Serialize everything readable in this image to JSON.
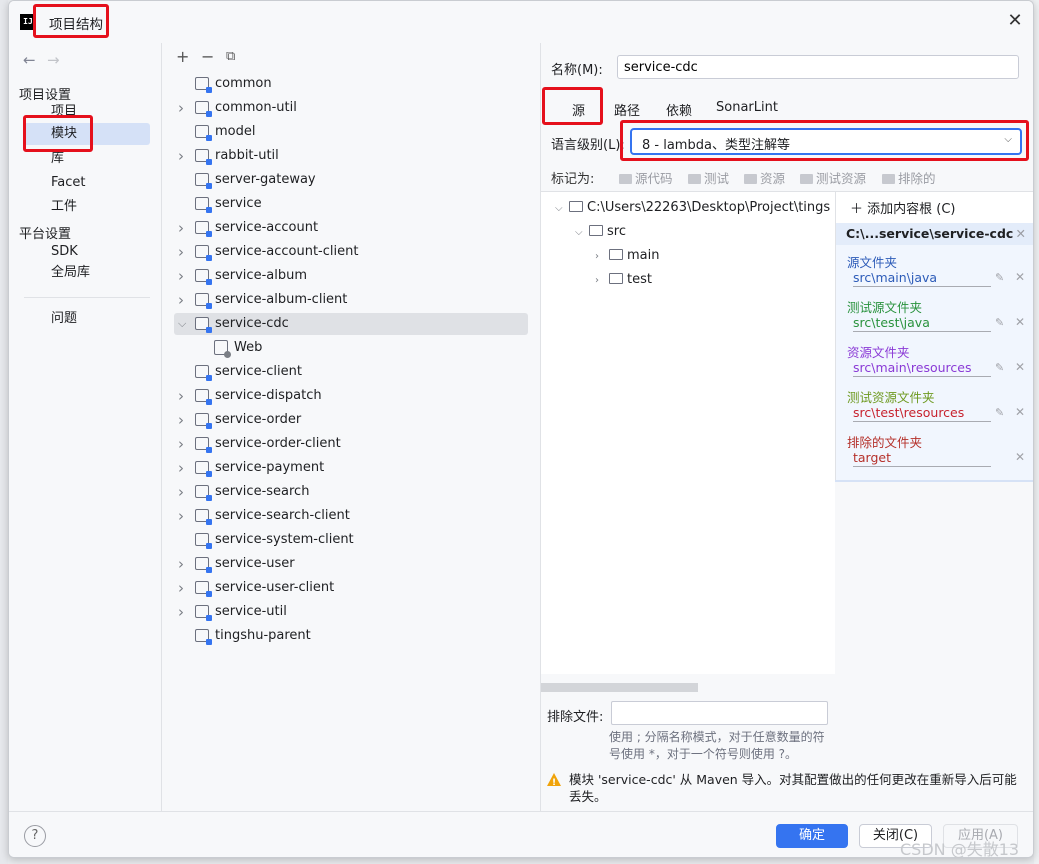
{
  "window": {
    "title": "项目结构",
    "close_icon": "close-icon"
  },
  "nav": {
    "project_settings": "项目设置",
    "items_project": [
      "项目",
      "模块",
      "库",
      "Facet",
      "工件"
    ],
    "platform_settings": "平台设置",
    "items_platform": [
      "SDK",
      "全局库"
    ],
    "problems": "问题",
    "selected": "模块"
  },
  "modules": {
    "toolbar": [
      "add-icon",
      "remove-icon",
      "copy-icon"
    ],
    "items": [
      {
        "label": "common",
        "expandable": false
      },
      {
        "label": "common-util",
        "expandable": true
      },
      {
        "label": "model",
        "expandable": false
      },
      {
        "label": "rabbit-util",
        "expandable": true
      },
      {
        "label": "server-gateway",
        "expandable": false
      },
      {
        "label": "service",
        "expandable": false
      },
      {
        "label": "service-account",
        "expandable": true
      },
      {
        "label": "service-account-client",
        "expandable": true
      },
      {
        "label": "service-album",
        "expandable": true
      },
      {
        "label": "service-album-client",
        "expandable": true
      },
      {
        "label": "service-cdc",
        "expandable": true,
        "expanded": true,
        "selected": true
      },
      {
        "label": "Web",
        "child": true
      },
      {
        "label": "service-client",
        "expandable": false
      },
      {
        "label": "service-dispatch",
        "expandable": true
      },
      {
        "label": "service-order",
        "expandable": true
      },
      {
        "label": "service-order-client",
        "expandable": true
      },
      {
        "label": "service-payment",
        "expandable": true
      },
      {
        "label": "service-search",
        "expandable": true
      },
      {
        "label": "service-search-client",
        "expandable": true
      },
      {
        "label": "service-system-client",
        "expandable": false
      },
      {
        "label": "service-user",
        "expandable": true
      },
      {
        "label": "service-user-client",
        "expandable": true
      },
      {
        "label": "service-util",
        "expandable": true
      },
      {
        "label": "tingshu-parent",
        "expandable": false
      }
    ]
  },
  "detail": {
    "name_label": "名称(M):",
    "name_value": "service-cdc",
    "tabs": [
      "源",
      "路径",
      "依赖",
      "SonarLint"
    ],
    "active_tab": "源",
    "lang_label": "语言级别(L):",
    "lang_value": "8 - lambda、类型注解等",
    "mark_as": "标记为:",
    "mark_buttons": [
      "源代码",
      "测试",
      "资源",
      "测试资源",
      "排除的"
    ],
    "dir_tree": [
      {
        "label": "C:\\Users\\22263\\Desktop\\Project\\tings",
        "depth": 0,
        "open": true
      },
      {
        "label": "src",
        "depth": 1,
        "open": true
      },
      {
        "label": "main",
        "depth": 2,
        "open": false
      },
      {
        "label": "test",
        "depth": 2,
        "open": false
      }
    ],
    "add_content_root": "添加内容根 (C)",
    "content_root": "C:\\...service\\service-cdc",
    "root_groups": [
      {
        "title": "源文件夹",
        "path": "src\\main\\java",
        "color": "#2c5bb8"
      },
      {
        "title": "测试源文件夹",
        "path": "src\\test\\java",
        "color": "#29923d"
      },
      {
        "title": "资源文件夹",
        "path": "src\\main\\resources",
        "color": "#8a39d6"
      },
      {
        "title": "测试资源文件夹",
        "path": "src\\test\\resources",
        "color": "#6e9a20",
        "path_color": "#c7222e"
      },
      {
        "title": "排除的文件夹",
        "path": "target",
        "color": "#b5302a"
      }
    ],
    "exclude_label": "排除文件:",
    "exclude_value": "",
    "exclude_hint": "使用 ; 分隔名称模式，对于任意数量的符号使用 *，对于一个符号则使用 ?。",
    "warning": "模块 'service-cdc' 从 Maven 导入。对其配置做出的任何更改在重新导入后可能丢失。"
  },
  "footer": {
    "ok": "确定",
    "close": "关闭(C)",
    "apply": "应用(A)",
    "help": "?"
  },
  "watermark": "CSDN @失散13"
}
